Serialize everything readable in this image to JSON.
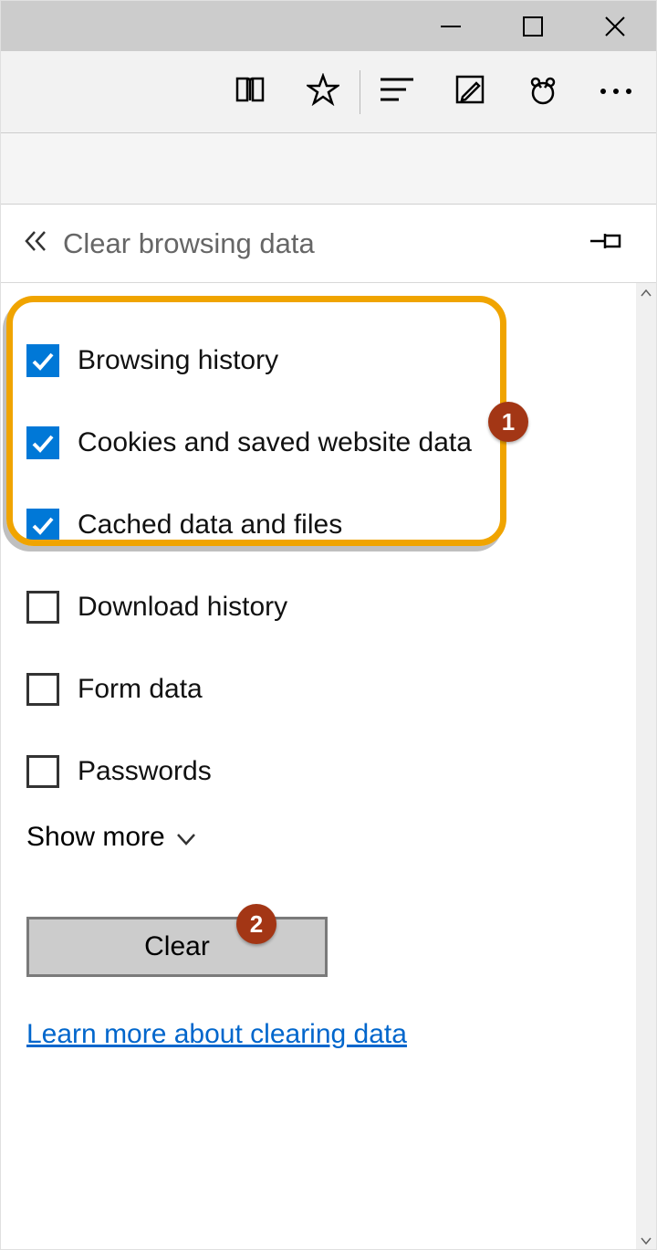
{
  "panel": {
    "title": "Clear browsing data"
  },
  "options": [
    {
      "label": "Browsing history",
      "checked": true
    },
    {
      "label": "Cookies and saved website data",
      "checked": true
    },
    {
      "label": "Cached data and files",
      "checked": true
    },
    {
      "label": "Download history",
      "checked": false
    },
    {
      "label": "Form data",
      "checked": false
    },
    {
      "label": "Passwords",
      "checked": false
    }
  ],
  "show_more": "Show more",
  "clear_button": "Clear",
  "learn_more": "Learn more about clearing data",
  "callouts": {
    "one": "1",
    "two": "2"
  }
}
